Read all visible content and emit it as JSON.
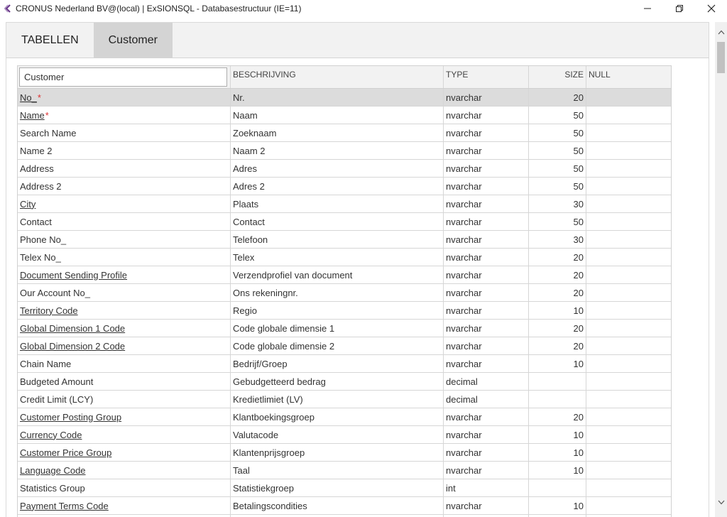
{
  "window": {
    "title": "CRONUS Nederland BV@(local) | ExSIONSQL - Databasestructuur (IE=11)",
    "icons": {
      "back": "chevron-left-icon",
      "minimize": "minimize-icon",
      "restore": "restore-icon",
      "close": "close-icon"
    }
  },
  "tabs": [
    {
      "label": "TABELLEN",
      "active": false
    },
    {
      "label": "Customer",
      "active": true
    }
  ],
  "grid": {
    "filter_value": "Customer",
    "headers": {
      "description": "BESCHRIJVING",
      "type": "TYPE",
      "size": "SIZE",
      "null": "NULL"
    },
    "rows": [
      {
        "name": "No_",
        "required": true,
        "link": true,
        "description": "Nr.",
        "type": "nvarchar",
        "size": "20",
        "null": ""
      },
      {
        "name": "Name",
        "required": true,
        "link": true,
        "description": "Naam",
        "type": "nvarchar",
        "size": "50",
        "null": ""
      },
      {
        "name": "Search Name",
        "required": false,
        "link": false,
        "description": "Zoeknaam",
        "type": "nvarchar",
        "size": "50",
        "null": ""
      },
      {
        "name": "Name 2",
        "required": false,
        "link": false,
        "description": "Naam 2",
        "type": "nvarchar",
        "size": "50",
        "null": ""
      },
      {
        "name": "Address",
        "required": false,
        "link": false,
        "description": "Adres",
        "type": "nvarchar",
        "size": "50",
        "null": ""
      },
      {
        "name": "Address 2",
        "required": false,
        "link": false,
        "description": "Adres 2",
        "type": "nvarchar",
        "size": "50",
        "null": ""
      },
      {
        "name": "City",
        "required": false,
        "link": true,
        "description": "Plaats",
        "type": "nvarchar",
        "size": "30",
        "null": ""
      },
      {
        "name": "Contact",
        "required": false,
        "link": false,
        "description": "Contact",
        "type": "nvarchar",
        "size": "50",
        "null": ""
      },
      {
        "name": "Phone No_",
        "required": false,
        "link": false,
        "description": "Telefoon",
        "type": "nvarchar",
        "size": "30",
        "null": ""
      },
      {
        "name": "Telex No_",
        "required": false,
        "link": false,
        "description": "Telex",
        "type": "nvarchar",
        "size": "20",
        "null": ""
      },
      {
        "name": "Document Sending Profile",
        "required": false,
        "link": true,
        "description": "Verzendprofiel van document",
        "type": "nvarchar",
        "size": "20",
        "null": ""
      },
      {
        "name": "Our Account No_",
        "required": false,
        "link": false,
        "description": "Ons rekeningnr.",
        "type": "nvarchar",
        "size": "20",
        "null": ""
      },
      {
        "name": "Territory Code",
        "required": false,
        "link": true,
        "description": "Regio",
        "type": "nvarchar",
        "size": "10",
        "null": ""
      },
      {
        "name": "Global Dimension 1 Code",
        "required": false,
        "link": true,
        "description": "Code globale dimensie 1",
        "type": "nvarchar",
        "size": "20",
        "null": ""
      },
      {
        "name": "Global Dimension 2 Code",
        "required": false,
        "link": true,
        "description": "Code globale dimensie 2",
        "type": "nvarchar",
        "size": "20",
        "null": ""
      },
      {
        "name": "Chain Name",
        "required": false,
        "link": false,
        "description": "Bedrijf/Groep",
        "type": "nvarchar",
        "size": "10",
        "null": ""
      },
      {
        "name": "Budgeted Amount",
        "required": false,
        "link": false,
        "description": "Gebudgetteerd bedrag",
        "type": "decimal",
        "size": "",
        "null": ""
      },
      {
        "name": "Credit Limit (LCY)",
        "required": false,
        "link": false,
        "description": "Kredietlimiet (LV)",
        "type": "decimal",
        "size": "",
        "null": ""
      },
      {
        "name": "Customer Posting Group",
        "required": false,
        "link": true,
        "description": "Klantboekingsgroep",
        "type": "nvarchar",
        "size": "20",
        "null": ""
      },
      {
        "name": "Currency Code",
        "required": false,
        "link": true,
        "description": "Valutacode",
        "type": "nvarchar",
        "size": "10",
        "null": ""
      },
      {
        "name": "Customer Price Group",
        "required": false,
        "link": true,
        "description": "Klantenprijsgroep",
        "type": "nvarchar",
        "size": "10",
        "null": ""
      },
      {
        "name": "Language Code",
        "required": false,
        "link": true,
        "description": "Taal",
        "type": "nvarchar",
        "size": "10",
        "null": ""
      },
      {
        "name": "Statistics Group",
        "required": false,
        "link": false,
        "description": "Statistiekgroep",
        "type": "int",
        "size": "",
        "null": ""
      },
      {
        "name": "Payment Terms Code",
        "required": false,
        "link": true,
        "description": "Betalingscondities",
        "type": "nvarchar",
        "size": "10",
        "null": ""
      },
      {
        "name": "",
        "required": false,
        "link": false,
        "description": "",
        "type": "",
        "size": "",
        "null": ""
      }
    ],
    "required_marker": "*",
    "selected_row_index": 0
  },
  "scrollbar": {
    "icons": {
      "up": "chevron-up-icon",
      "down": "chevron-down-icon"
    }
  },
  "colors": {
    "tab_active_bg": "#d4d4d4",
    "tab_bar_bg": "#f2f2f2",
    "selected_row_bg": "#dcdcdc",
    "required_marker": "#dd3333",
    "back_icon": "#6b3a8c"
  }
}
